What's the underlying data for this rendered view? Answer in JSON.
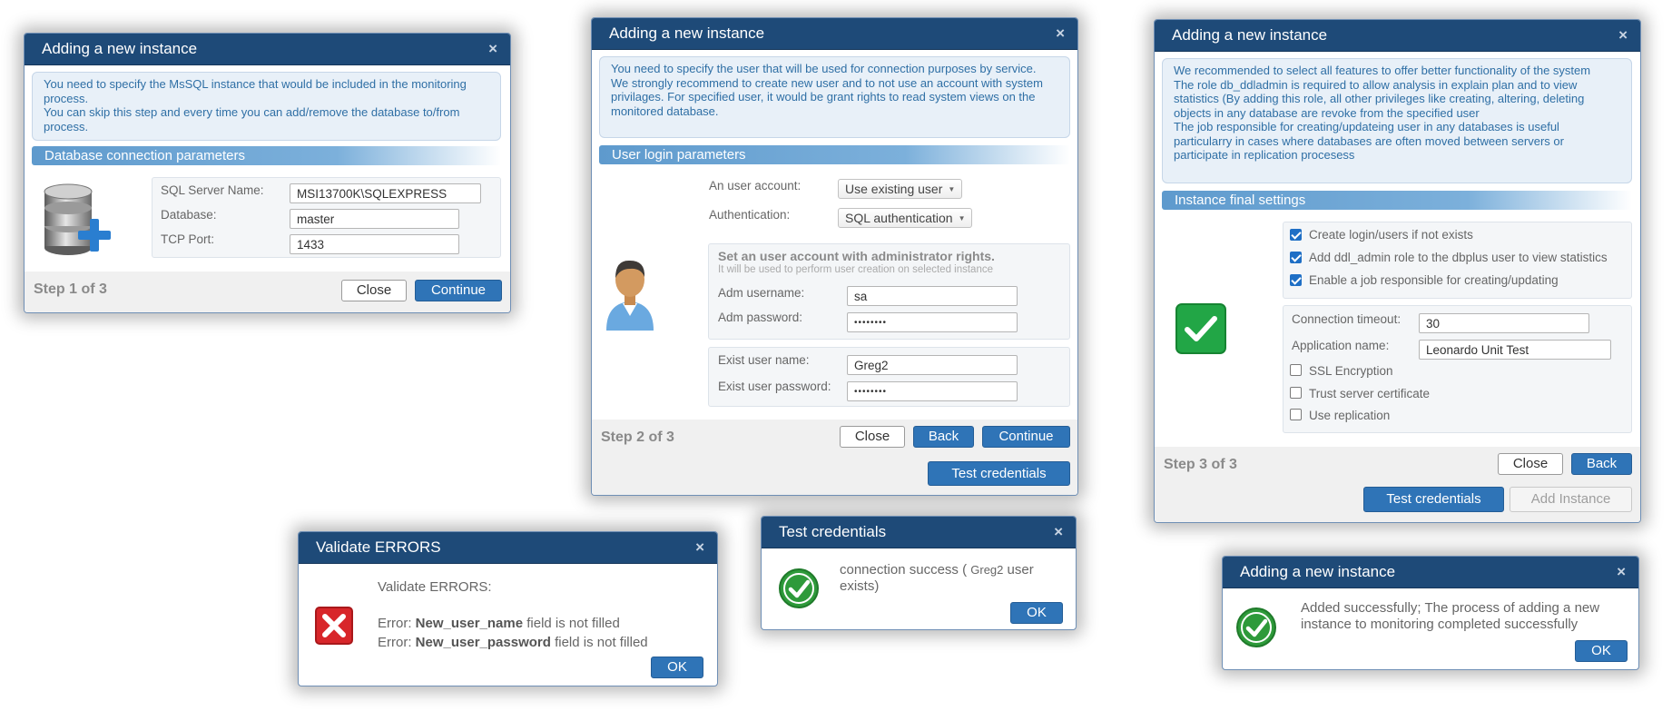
{
  "step1": {
    "title": "Adding a new instance",
    "close_x": "×",
    "info_line1": "You need to specify the MsSQL instance that would be included in the monitoring process.",
    "info_line2": "You can skip this step and every time you can add/remove the database to/from process.",
    "section": "Database connection parameters",
    "server_label": "SQL Server Name:",
    "server_value": "MSI13700K\\SQLEXPRESS",
    "database_label": "Database:",
    "database_value": "master",
    "port_label": "TCP Port:",
    "port_value": "1433",
    "step": "Step 1 of 3",
    "close_btn": "Close",
    "continue_btn": "Continue"
  },
  "step2": {
    "title": "Adding a new instance",
    "close_x": "×",
    "info_line1": "You need to specify the user that will be used for connection purposes by service.",
    "info_line2": "We strongly recommend to create new user and to not use an account with system privilages. For specified user, it would be grant rights to read system views on the monitored database.",
    "section": "User login parameters",
    "account_label": "An user account:",
    "account_value": "Use existing user",
    "auth_label": "Authentication:",
    "auth_value": "SQL authentication",
    "admin_header": "Set an user account with administrator rights.",
    "admin_sub": "It will be used to perform user creation on selected instance",
    "adm_user_label": "Adm username:",
    "adm_user_value": "sa",
    "adm_pass_label": "Adm password:",
    "adm_pass_value": "••••••••",
    "exist_user_label": "Exist user name:",
    "exist_user_value": "Greg2",
    "exist_pass_label": "Exist user password:",
    "exist_pass_value": "••••••••",
    "step": "Step 2 of 3",
    "close_btn": "Close",
    "back_btn": "Back",
    "continue_btn": "Continue",
    "test_btn": "Test credentials"
  },
  "step3": {
    "title": "Adding a new instance",
    "close_x": "×",
    "info_line1": "We recommended to select all features to offer better functionality of the system",
    "info_line2": "The role db_ddladmin is required to allow analysis in explain plan and to view statistics (By adding this role, all other privileges like creating, altering, deleting objects in any database are revoke from the specified user",
    "info_line3": "The job responsible for creating/updateing user in any databases is useful particularry in cases where databases are often moved between servers or participate in replication procesess",
    "section": "Instance final settings",
    "chk1_label": "Create  login/users if not exists",
    "chk1_checked": true,
    "chk2_label": "Add ddl_admin role to the dbplus user to view statistics",
    "chk2_checked": true,
    "chk3_label": "Enable a job responsible for creating/updating",
    "chk3_checked": true,
    "timeout_label": "Connection timeout:",
    "timeout_value": "30",
    "appname_label": "Application name:",
    "appname_value": "Leonardo Unit Test",
    "ssl_label": "SSL Encryption",
    "ssl_checked": false,
    "trust_label": "Trust server certificate",
    "trust_checked": false,
    "repl_label": "Use replication",
    "repl_checked": false,
    "step": "Step 3 of 3",
    "close_btn": "Close",
    "back_btn": "Back",
    "test_btn": "Test credentials",
    "add_btn": "Add Instance"
  },
  "validate": {
    "title": "Validate ERRORS",
    "close_x": "×",
    "heading": "Validate ERRORS:",
    "err_prefix": "Error: ",
    "err1_field": "New_user_name",
    "err2_field": "New_user_password",
    "err_suffix": " field is not filled",
    "ok_btn": "OK"
  },
  "testcred": {
    "title": "Test credentials",
    "close_x": "×",
    "message_a": "connection success ( ",
    "message_user": "Greg2",
    "message_b": "  user exists)",
    "ok_btn": "OK"
  },
  "added": {
    "title": "Adding a new instance",
    "close_x": "×",
    "message": "Added successfully; The process of adding a new instance to monitoring completed successfully",
    "ok_btn": "OK"
  },
  "colors": {
    "titlebar": "#1e4a78",
    "button_blue": "#2f74b7",
    "info_text": "#2f6fa5",
    "success_green": "#2e9a3a",
    "error_red": "#d8262a"
  }
}
